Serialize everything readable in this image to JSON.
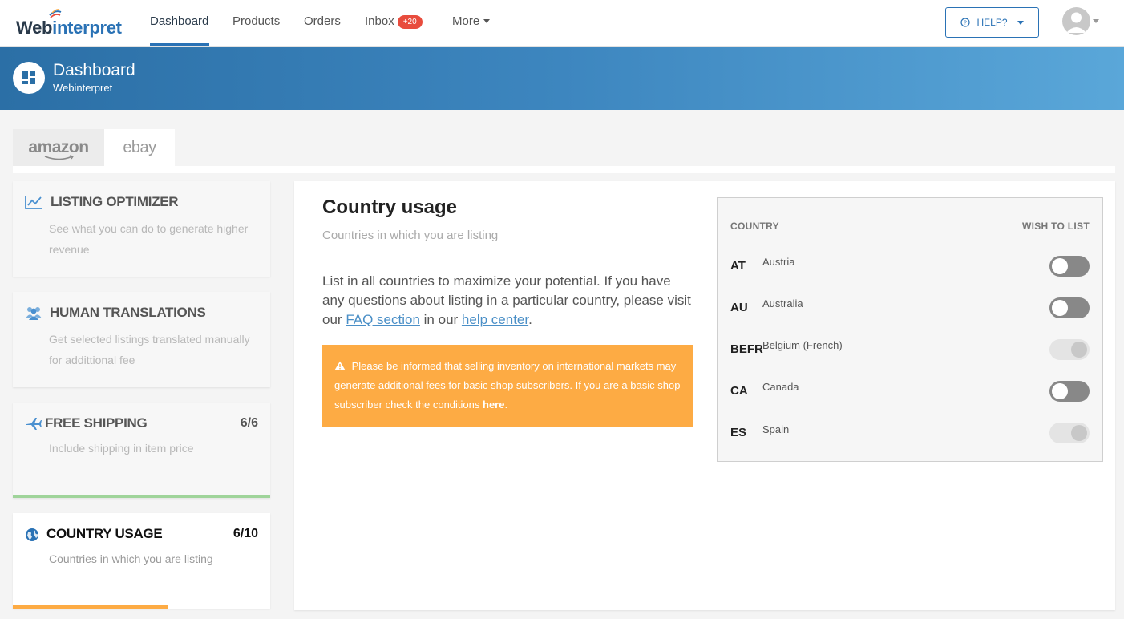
{
  "brand": {
    "logo_part1": "Web",
    "logo_part2": "interpret"
  },
  "nav": {
    "items": [
      {
        "label": "Dashboard"
      },
      {
        "label": "Products"
      },
      {
        "label": "Orders"
      },
      {
        "label": "Inbox"
      },
      {
        "label": "More"
      }
    ],
    "inbox_badge": "+20",
    "help_label": "HELP?"
  },
  "header": {
    "title": "Dashboard",
    "subtitle": "Webinterpret"
  },
  "marketplaces": [
    {
      "label": "amazon"
    },
    {
      "label": "ebay"
    }
  ],
  "sidebar": {
    "cards": [
      {
        "title": "LISTING OPTIMIZER",
        "desc": "See what you can do to generate higher revenue",
        "count": "",
        "icon": "chart-line-icon"
      },
      {
        "title": "HUMAN TRANSLATIONS",
        "desc": "Get selected listings translated manually for addittional fee",
        "count": "",
        "icon": "users-icon"
      },
      {
        "title": "FREE SHIPPING",
        "desc": "Include shipping in item price",
        "count": "6/6",
        "icon": "airplane-icon",
        "progress": 1.0,
        "progress_color": "#9fd49a"
      },
      {
        "title": "COUNTRY USAGE",
        "desc": "Countries in which you are listing",
        "count": "6/10",
        "icon": "globe-icon",
        "progress": 0.6,
        "progress_color": "#fdab44"
      }
    ]
  },
  "main": {
    "title": "Country usage",
    "subtitle": "Countries in which you are listing",
    "body_text": "List in all countries to maximize your potential. If you have any questions about listing in a particular country, please visit our",
    "faq_link": "FAQ section",
    "body_mid": "in our",
    "help_link": "help center",
    "body_end": ".",
    "alert_text": "Please be informed that selling inventory on international markets may generate additional fees for basic shop subscribers. If you are a basic shop subscriber check the conditions",
    "alert_link": "here",
    "alert_end": "."
  },
  "country_table": {
    "col_country": "COUNTRY",
    "col_wish": "WISH TO LIST",
    "rows": [
      {
        "code": "AT",
        "name": "Austria",
        "enabled": false,
        "disabled": false
      },
      {
        "code": "AU",
        "name": "Australia",
        "enabled": false,
        "disabled": false
      },
      {
        "code": "BEFR",
        "name": "Belgium (French)",
        "enabled": true,
        "disabled": true
      },
      {
        "code": "CA",
        "name": "Canada",
        "enabled": false,
        "disabled": false
      },
      {
        "code": "ES",
        "name": "Spain",
        "enabled": true,
        "disabled": true
      }
    ]
  },
  "colors": {
    "brand_blue": "#2a72b5",
    "badge_red": "#e84c3d",
    "alert_orange": "#fdab44",
    "progress_green": "#9fd49a"
  }
}
